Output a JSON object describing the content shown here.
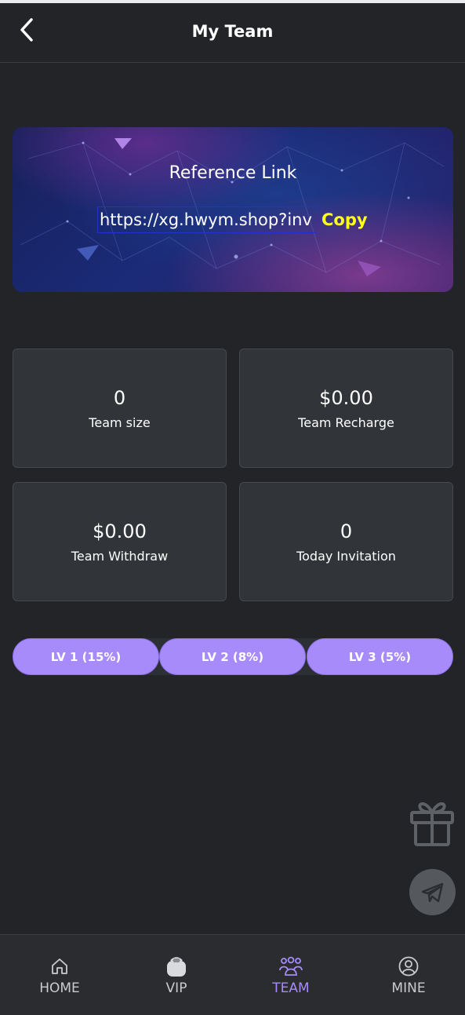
{
  "header": {
    "title": "My Team",
    "back_icon": "chevron-left-icon"
  },
  "reference": {
    "title": "Reference Link",
    "link": "https://xg.hwym.shop?inv",
    "copy_label": "Copy"
  },
  "stats": [
    {
      "value": "0",
      "label": "Team size"
    },
    {
      "value": "$0.00",
      "label": "Team Recharge"
    },
    {
      "value": "$0.00",
      "label": "Team Withdraw"
    },
    {
      "value": "0",
      "label": "Today Invitation"
    }
  ],
  "levels": [
    {
      "label": "LV 1 (15%)"
    },
    {
      "label": "LV 2 (8%)"
    },
    {
      "label": "LV 3 (5%)"
    }
  ],
  "floating": {
    "gift_icon": "gift-icon",
    "telegram_icon": "telegram-icon"
  },
  "nav": [
    {
      "label": "HOME",
      "icon": "home-icon",
      "active": false
    },
    {
      "label": "VIP",
      "icon": "vip-icon",
      "active": false
    },
    {
      "label": "TEAM",
      "icon": "team-icon",
      "active": true
    },
    {
      "label": "MINE",
      "icon": "user-icon",
      "active": false
    }
  ],
  "colors": {
    "background": "#222428",
    "card": "#313438",
    "accent": "#a78bfa",
    "copy": "#ffff1a"
  }
}
